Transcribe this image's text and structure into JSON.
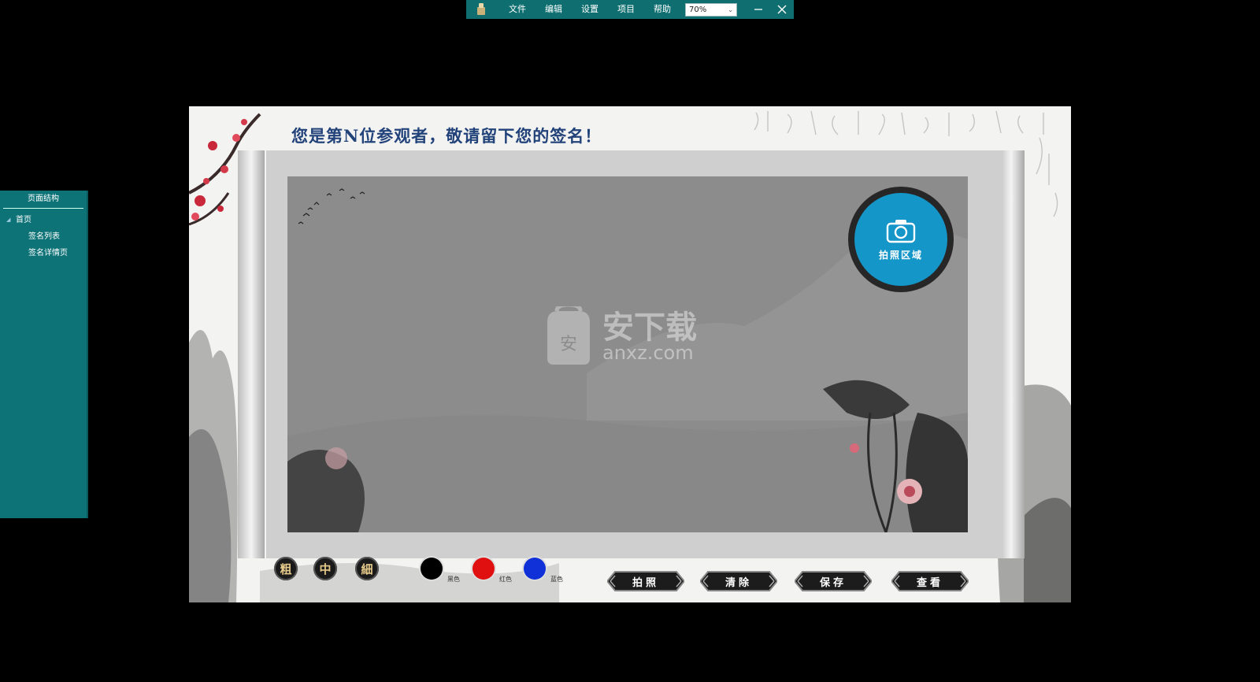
{
  "menubar": {
    "items": [
      "文件",
      "编辑",
      "设置",
      "项目",
      "帮助"
    ],
    "zoom": "70%"
  },
  "side_panel": {
    "title": "页面结构",
    "root": "首页",
    "children": [
      "签名列表",
      "签名详情页"
    ]
  },
  "stage": {
    "headline": "您是第N位参观者，敬请留下您的签名！",
    "photo_zone_label": "拍照区域",
    "watermark_cn": "安下载",
    "watermark_en": "anxz.com",
    "watermark_badge": "安"
  },
  "toolbar": {
    "stroke_sizes": [
      "粗",
      "中",
      "細"
    ],
    "colors": [
      {
        "label": "黑色",
        "hex": "#000000"
      },
      {
        "label": "红色",
        "hex": "#e01010"
      },
      {
        "label": "蓝色",
        "hex": "#1030d8"
      }
    ],
    "actions": [
      "拍照",
      "清除",
      "保存",
      "查看"
    ]
  },
  "theme": {
    "menubar_bg": "#0f6f70",
    "headline_color": "#22427a",
    "photo_zone_color": "#1596c8"
  }
}
